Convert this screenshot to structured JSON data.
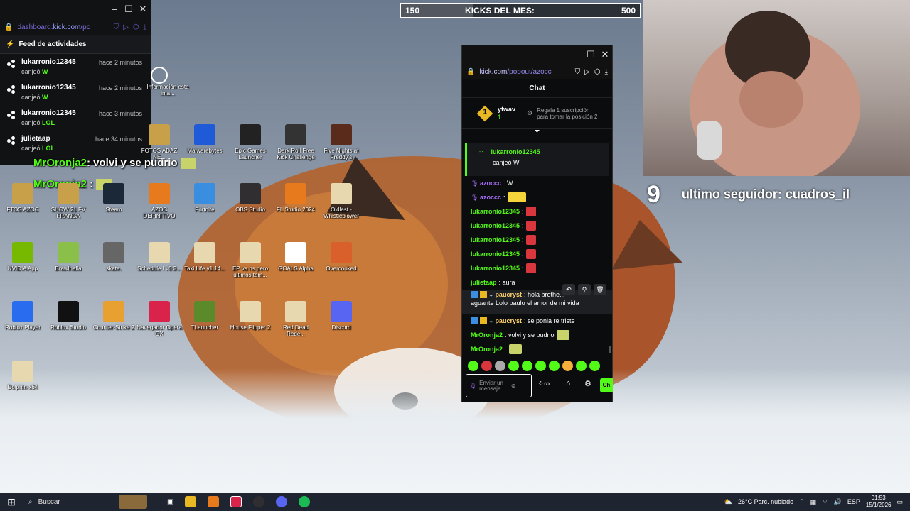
{
  "feed": {
    "url_prefix": "dashboard.",
    "url_domain": "kick.com",
    "url_suffix": "/pc",
    "header": "Feed de actividades",
    "items": [
      {
        "user": "lukarronio12345",
        "time": "hace 2 minutos",
        "verb": "canjeó",
        "reward": "W"
      },
      {
        "user": "lukarronio12345",
        "time": "hace 2 minutos",
        "verb": "canjeó",
        "reward": "W"
      },
      {
        "user": "lukarronio12345",
        "time": "hace 3 minutos",
        "verb": "canjeó",
        "reward": "LOL"
      },
      {
        "user": "julietaap",
        "time": "hace 34 minutos",
        "verb": "canjeó",
        "reward": "LOL"
      }
    ]
  },
  "overlay_chat": [
    {
      "user": "MrOronja2",
      "text": ": volvi y se pudrio"
    },
    {
      "user": "MrOronja2",
      "text": " :"
    }
  ],
  "kicks": {
    "left": "150",
    "label": "KICKS DEL MES:",
    "right": "500",
    "progress": 0.3
  },
  "follower": {
    "count": "9",
    "label": "ultimo seguidor: cuadros_il"
  },
  "desktop_icons": [
    {
      "label": "Información esta ima...",
      "color": "#444"
    },
    {
      "label": "FOTOS ADAZ NE...",
      "color": "#c8a04a"
    },
    {
      "label": "Malwarebytes",
      "color": "#1f5ad8"
    },
    {
      "label": "Epic Games Launcher",
      "color": "#222"
    },
    {
      "label": "Dark Roll Free Kick Challenge",
      "color": "#333"
    },
    {
      "label": "Five Nights at Freddy's",
      "color": "#5a2a1a"
    },
    {
      "label": "FTOS AZOC",
      "color": "#c8a04a"
    },
    {
      "label": "SHOW 21 FV FRANCA",
      "color": "#c8a04a"
    },
    {
      "label": "Steam",
      "color": "#1b2838"
    },
    {
      "label": "AZOC DEFINITIVO",
      "color": "#e87a1e"
    },
    {
      "label": "Fortnite",
      "color": "#3a8ee0"
    },
    {
      "label": "OBS Studio",
      "color": "#302e31"
    },
    {
      "label": "FL Studio 2024",
      "color": "#e87a1e"
    },
    {
      "label": "Oldlast - Whistleblower",
      "color": "#e8d8b0"
    },
    {
      "label": "NVIDIA App",
      "color": "#76b900"
    },
    {
      "label": "Brawlhalla",
      "color": "#8abf4a"
    },
    {
      "label": "skate.",
      "color": "#666"
    },
    {
      "label": "Schedule I v0.3...",
      "color": "#e8d8b0"
    },
    {
      "label": "Taxi Life v1.14...",
      "color": "#e8d8b0"
    },
    {
      "label": "EP va ns pero ultimos tem...",
      "color": "#e8d8b0"
    },
    {
      "label": "GOALS Alpha",
      "color": "#fff"
    },
    {
      "label": "Overcooked",
      "color": "#d9602a"
    },
    {
      "label": "Roblox Player",
      "color": "#2a6cf0"
    },
    {
      "label": "Roblox Studio",
      "color": "#111"
    },
    {
      "label": "Counter-Strike 2",
      "color": "#e8a030"
    },
    {
      "label": "Navegador Opera GX",
      "color": "#d9234a"
    },
    {
      "label": "TLauncher",
      "color": "#5a8a2a"
    },
    {
      "label": "House Flipper 2",
      "color": "#e8d8b0"
    },
    {
      "label": "Red Dead Rede...",
      "color": "#e8d8b0"
    },
    {
      "label": "Discord",
      "color": "#5865f2"
    },
    {
      "label": "Dolphin-x64",
      "color": "#e8d8b0"
    }
  ],
  "chat": {
    "url_domain": "kick.com",
    "url_path": "/popout/azocc",
    "title": "Chat",
    "pinned_user": "yfwav",
    "pinned_rank": "1",
    "pinned_count": "1",
    "pinned_gift": "Regala 1 suscripción para tomar la posición 2",
    "redeem_user": "lukarronio12345",
    "redeem_text": "canjeó W",
    "messages": [
      {
        "user": "azoccc",
        "text": ": W",
        "color": "#a970ff"
      },
      {
        "user": "azoccc",
        "text": ":",
        "color": "#a970ff"
      },
      {
        "user": "lukarronio12345",
        "text": ":",
        "color": "#53fc18"
      },
      {
        "user": "lukarronio12345",
        "text": ":",
        "color": "#53fc18"
      },
      {
        "user": "lukarronio12345",
        "text": ":",
        "color": "#53fc18"
      },
      {
        "user": "lukarronio12345",
        "text": ":",
        "color": "#53fc18"
      },
      {
        "user": "lukarronio12345",
        "text": ":",
        "color": "#53fc18"
      },
      {
        "user": "julietaap",
        "text": ": aura",
        "color": "#53fc18"
      },
      {
        "user": "paucryst",
        "text": ": hola brothe...",
        "text2": "aguante Lolo baulo el amor de mi vida",
        "color": "#ffd36b"
      },
      {
        "user": "paucryst",
        "text": ": se ponia re triste",
        "color": "#ffd36b"
      },
      {
        "user": "MrOronja2",
        "text": ": volvi y se pudrio",
        "color": "#53fc18"
      },
      {
        "user": "MrOronja2",
        "text": ":",
        "color": "#53fc18"
      }
    ],
    "input_placeholder": "Enviar un mensaje",
    "points_label": "∞",
    "send_label": "Ch"
  },
  "taskbar": {
    "search": "Buscar",
    "weather": "26°C  Parc. nublado",
    "lang": "ESP",
    "time": "01:53",
    "date": "15/1/2026"
  }
}
